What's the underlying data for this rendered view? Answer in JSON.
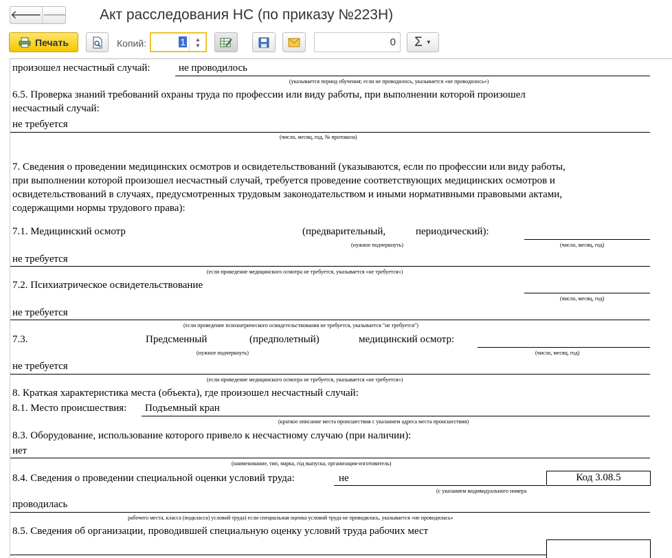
{
  "window": {
    "title": "Акт расследования НС (по приказу №223Н)",
    "back_glyph": "🡐",
    "forward_glyph": "🡒"
  },
  "toolbar": {
    "print_label": "Печать",
    "copies_label": "Копий:",
    "copies_value": "1",
    "number_value": "0",
    "sum_glyph": "Σ"
  },
  "doc": {
    "l1": "произошел несчастный случай:",
    "v1": "не проводилось",
    "n1": "(указывается период обучения; если не проводилось, указывается «не проводилось»)",
    "p65a": "6.5. Проверка знаний требований охраны труда по профессии или виду работы, при выполнении которой произошел",
    "p65b": "несчастный случай:",
    "v65": "не требуется",
    "n65": "(число, месяц, год, № протокола)",
    "p7a": "7. Сведения о проведении медицинских осмотров и освидетельствований (указываются, если по профессии или виду работы,",
    "p7b": "при выполнении которой произошел несчастный случай, требуется проведение соответствующих медицинских осмотров и",
    "p7c": "освидетельствований в случаях, предусмотренных трудовым законодательством и иными нормативными правовыми актами,",
    "p7d": "содержащими нормы трудового права):",
    "p71": "7.1. Медицинский осмотр",
    "p71b": "(предварительный,",
    "p71c": "периодический):",
    "n71a": "(нужное подчеркнуть)",
    "n71b": "(число, месяц, год)",
    "v71": "не требуется",
    "n71c": "(если проведение медицинского осмотра не требуется, указывается «не требуется»)",
    "p72": "7.2. Психиатрическое освидетельствование",
    "n72a": "(число, месяц, год)",
    "v72": "не требуется",
    "n72b": "(если проведение психиатрического освидетельствования не требуется, указывается \"не требуется\")",
    "p73": "7.3.",
    "p73b": "Предсменный",
    "p73c": "(предполетный)",
    "p73d": "медицинский осмотр:",
    "n73a": "(нужное подчеркнуть)",
    "n73b": "(число, месяц, год)",
    "v73": "не требуется",
    "n73c": "(если проведение медицинского осмотра не требуется, указывается «не требуется»)",
    "p8": "8. Краткая характеристика места (объекта), где произошел несчастный случай:",
    "p81": "8.1. Место происшествия:",
    "v81": "Подъемный кран",
    "n81": "(краткое описание места происшествия с указанием адреса места происшествия)",
    "p83": "8.3. Оборудование, использование которого привело к несчастному случаю (при наличии):",
    "v83": "нет",
    "n83": "(наименование, тип, марка, год выпуска, организация-изготовитель)",
    "p84": "8.4. Сведения о проведении специальной оценки условий труда:",
    "v84": "не",
    "kod": "Код 3.08.5",
    "n84a": "(с указанием индивидуального номера",
    "v84b": "проводилась",
    "n84b": "рабочего места, класса (подкласса) условий труда) если специальная оценка условий труда не проводилась, указывается «не проводилась»",
    "p85": "8.5. Сведения об организации, проводившей специальную оценку условий труда рабочих мест"
  }
}
